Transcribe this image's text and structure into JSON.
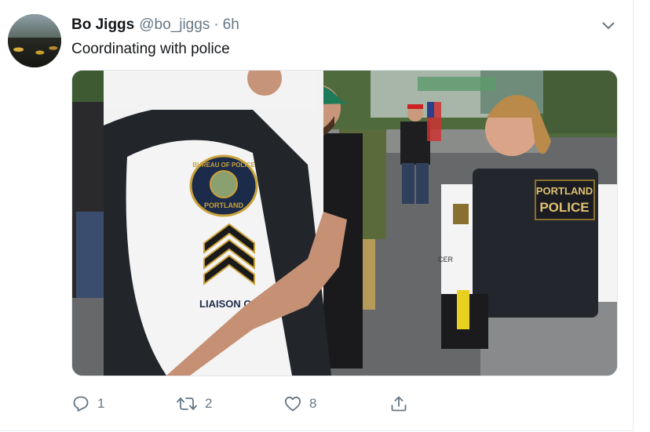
{
  "tweet": {
    "author_name": "Bo Jiggs",
    "handle": "@bo_jiggs",
    "separator": "·",
    "time": "6h",
    "text": "Coordinating with police",
    "media": {
      "patch_lines": [
        "BUREAU OF POLICE",
        "PORTLAND"
      ],
      "sleeve_text": "LIAISON OFFI",
      "vest_lines": [
        "PORTLAND",
        "POLICE"
      ],
      "vest_side_label": "CER"
    },
    "actions": {
      "reply_count": "1",
      "retweet_count": "2",
      "like_count": "8"
    }
  },
  "icons": {
    "caret": "chevron-down-icon",
    "reply": "reply-icon",
    "retweet": "retweet-icon",
    "like": "heart-icon",
    "share": "share-icon"
  },
  "colors": {
    "text": "#14171a",
    "secondary": "#657786",
    "border": "#e6ecf0"
  }
}
